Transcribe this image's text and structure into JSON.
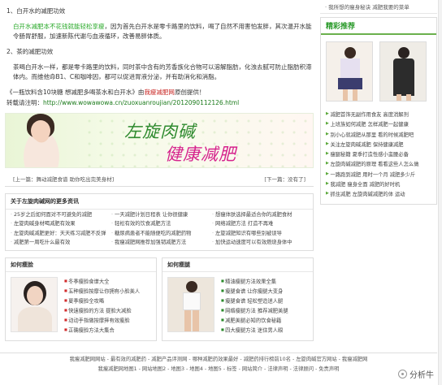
{
  "article": {
    "h1": "1、白开水的减肥功效",
    "p1_green": "白开水减肥本不花钱就能轻松享瘦",
    "p1_rest": "，因为首先白开水是零卡路里的饮料，喝了自然不用害怕发胖，其次温开水能令肠胃舒服，加速新陈代谢与血液循环，改善易胖体质。",
    "h2": "2、茶的减肥功效",
    "p2": "茶喝白开水一样，都是零卡路里的饮料，同时茶中含有的芳香族化合物可以溶解脂肪，化浊去腻可防止脂肪积滞体内。而维他命B1、C和咖啡因，都可以促进胃液分泌，并有助消化和消脂。",
    "source_pre": "《一瓶饮料含10块糖 想减肥多喝茶水和白开水》由",
    "source_site": "我瘦减肥网",
    "source_post": "原创提供！",
    "repost_label": "转载请注明：",
    "repost_url": "http://www.wowawowa.cn/zuoxuanroujian/2012090112126.html"
  },
  "banner": {
    "line1": "左旋肉碱",
    "line2": "健康减肥"
  },
  "pager": {
    "prev": "[上一篇：舞动减肥食谱 助你吃出完美身材]",
    "next": "[下一篇：没有了]"
  },
  "more": {
    "title": "关于左旋肉碱网的更多资讯",
    "items": [
      "25岁之后如何面对不可避免的减肥",
      "一天减肥计划日程表 让你很健康",
      "想瘦体肤选择最适合你的减肥食材",
      "左旋肉碱身材喝减肥有效果",
      "轻松有效的饮食减肥方法",
      "网络减肥方法 打造不再难",
      "左旋肉碱减肥更好：天天练习减肥不反弹",
      "糖尿病患者不能随便吃的减肥药物",
      "左旋减肥知识有哪些别被误导",
      "减肥第一周吃什么最有效",
      "我瘦减肥网推荐加强韧减肥方法",
      "加快运动速度可以有效燃烧身体中"
    ]
  },
  "box_left": {
    "title": "如何瘦脸",
    "items": [
      "冬季瘦脸食谱大全",
      "五种瘦脸按摩让你拥有小脸美人",
      "夏季瘦脸全攻略",
      "快速瘦脸的方法 提脸大减脸",
      "动动手指做按摩摔有效瘦脸",
      "正确瘦脸方法大集合"
    ]
  },
  "box_right": {
    "title": "如何瘦腿",
    "items": [
      "精油瘦腿方法效果全集",
      "瘦腿食谱 让你瘦腿大变身",
      "瘦腿食谱 轻松塑造迷人腿",
      "网络瘦腿方法 推荐减肥美腿",
      "减肥美腿必知的饮食秘籍",
      "四大瘦腿方法 迷住男人眼"
    ]
  },
  "sidebar": {
    "top_item": "· 我所想的瘦身秘诀 减肥我要的菜单",
    "rec_title": "精彩推荐",
    "items": [
      "减肥首饰无副作用食友 高度消解剂",
      "上班族如何减肥 怎样减肥一起健康",
      "别小心就减肥从那里 看的时候减肥吧",
      "关注左旋肉碱减肥 保持健康减肥",
      "瘦腿秘籍 夏季打造性感小蛮腰必备",
      "左旋肉碱减肥的原理 看看这些人怎么做",
      "一路跑到减肥 用时一个月 减肥多少斤",
      "我减肥 瘦身全面 减肥的好时机",
      "抓住减肥 左旋肉碱减肥的体 运动"
    ]
  },
  "footer": {
    "line1": "我瘦减肥网网站 - 最有效的减肥药 - 减肥产品评测网 - 哪种减肥药效果最好 - 减肥药排行榜前10名 - 左旋肉碱官方网站 - 我瘦减肥网",
    "line2": "我瘦减肥网地图1 - 网站地图2 - 地图3 - 地图4 - 地图5 - 标签 - 网站简介 - 法律声明 - 法律顾问 - 免责声明",
    "brand": "分析牛"
  }
}
